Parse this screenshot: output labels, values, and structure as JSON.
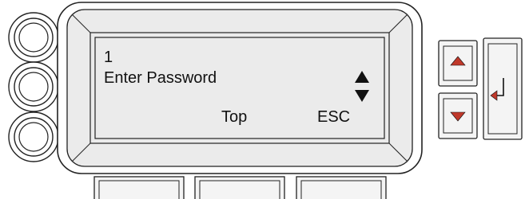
{
  "display": {
    "line1": "1",
    "line2": "Enter Password",
    "softkey_left": "Top",
    "softkey_right": "ESC",
    "scroll_indicator": "up-down-arrows-icon"
  },
  "colors": {
    "outline": "#222222",
    "bezel_fill": "#ebebeb",
    "screen_fill": "#ebebeb",
    "button_fill": "#f4f4f4",
    "arrow_red": "#c0392b",
    "text": "#111111"
  },
  "controls": {
    "left_knobs": [
      "knob-top",
      "knob-middle",
      "knob-bottom"
    ],
    "softkeys": [
      "softkey-1",
      "softkey-2",
      "softkey-3"
    ],
    "nav": [
      "up-arrow-button",
      "down-arrow-button",
      "enter-button"
    ]
  }
}
